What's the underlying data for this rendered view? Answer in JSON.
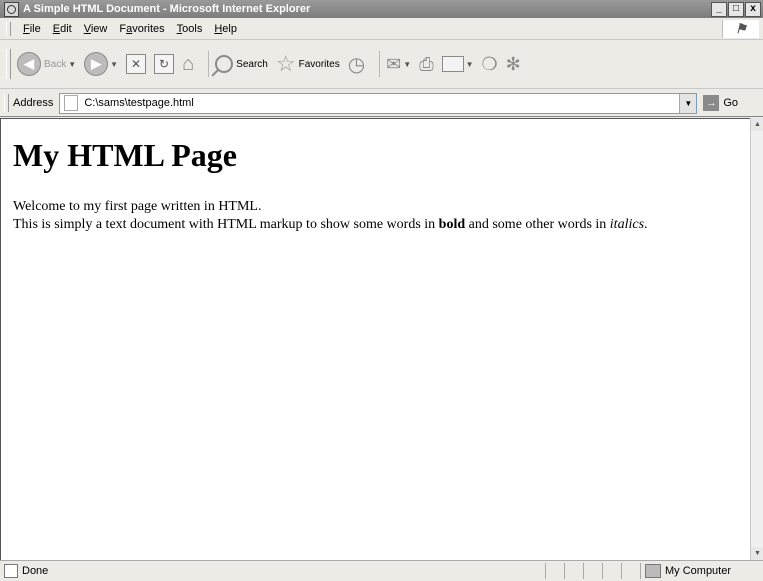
{
  "window": {
    "title": "A Simple HTML Document - Microsoft Internet Explorer",
    "min_label": "_",
    "max_label": "□",
    "close_label": "x"
  },
  "menu": [
    {
      "label": "File",
      "key": "F",
      "rest": "ile"
    },
    {
      "label": "Edit",
      "key": "E",
      "rest": "dit"
    },
    {
      "label": "View",
      "key": "V",
      "rest": "iew"
    },
    {
      "label": "Favorites",
      "key": "a",
      "pre": "F",
      "rest": "vorites"
    },
    {
      "label": "Tools",
      "key": "T",
      "rest": "ools"
    },
    {
      "label": "Help",
      "key": "H",
      "rest": "elp"
    }
  ],
  "toolbar": {
    "back_label": "Back",
    "search_label": "Search",
    "favorites_label": "Favorites"
  },
  "address": {
    "label": "Address",
    "label_key": "d",
    "value": "C:\\sams\\testpage.html",
    "go_label": "Go"
  },
  "page": {
    "heading": "My HTML Page",
    "line1": "Welcome to my first page written in HTML.",
    "line2_before": "This is simply a text document with HTML markup to show some words in ",
    "line2_bold": "bold",
    "line2_middle": " and some other words in ",
    "line2_italic": "italics",
    "line2_after": "."
  },
  "status": {
    "text": "Done",
    "zone": "My Computer"
  }
}
